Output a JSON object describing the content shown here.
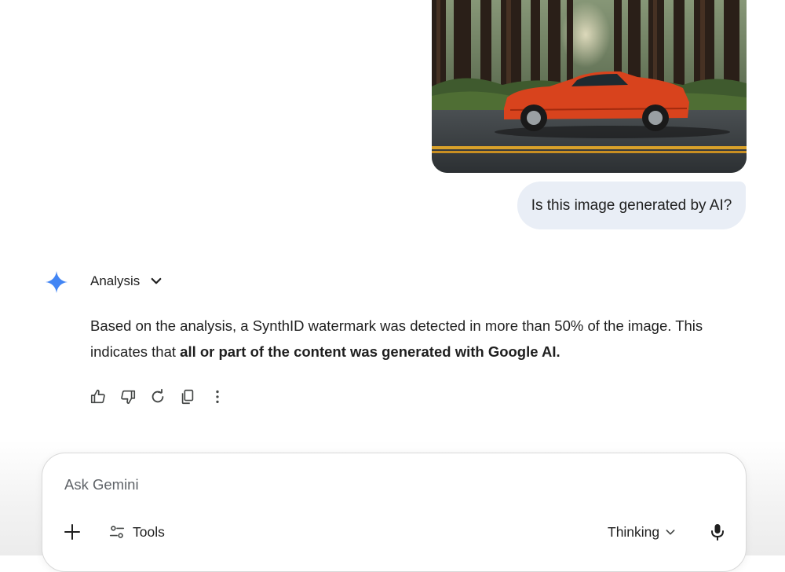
{
  "conversation": {
    "user_image_alt": "Orange sports car on a forest road",
    "user_message": "Is this image generated by AI?"
  },
  "response": {
    "header_label": "Analysis",
    "body_plain": "Based on the analysis, a SynthID watermark was detected in more than 50% of the image. This indicates that ",
    "body_bold": "all or part of the content was generated with Google AI."
  },
  "actions": {
    "icons": [
      "thumb-up-icon",
      "thumb-down-icon",
      "redo-icon",
      "copy-icon",
      "more-vert-icon"
    ]
  },
  "input": {
    "placeholder": "Ask Gemini",
    "value": "",
    "tools_label": "Tools",
    "mode_label": "Thinking"
  },
  "colors": {
    "user_bubble_bg": "#e9eef6",
    "gemini_star": "#4285f4",
    "text": "#1f1f1f",
    "placeholder": "#5f6368",
    "car": "#d8431d"
  }
}
